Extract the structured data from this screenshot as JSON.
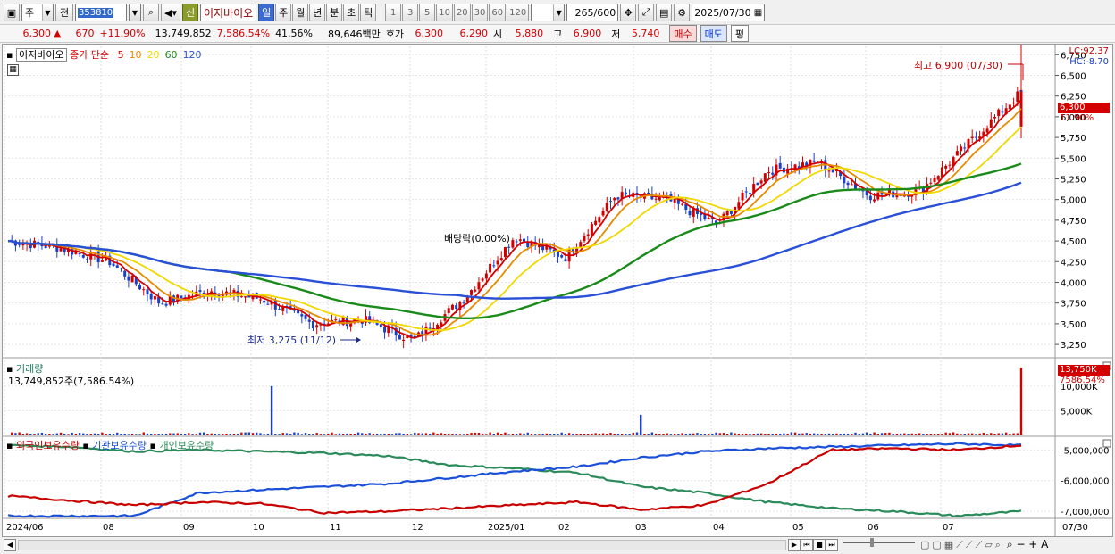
{
  "toolbar": {
    "market_select": "주",
    "prev_label": "전",
    "code": "353810",
    "sin_label": "신",
    "stock_name": "이지바이오",
    "periods": [
      "일",
      "주",
      "월",
      "년",
      "분",
      "초",
      "틱"
    ],
    "active_period": "일",
    "intervals": [
      "1",
      "3",
      "5",
      "10",
      "20",
      "30",
      "60",
      "120"
    ],
    "count": "265",
    "count_total": "/600",
    "date": "2025/07/30"
  },
  "quote": {
    "price": "6,300",
    "change": "670",
    "change_pct": "+11.90%",
    "volume": "13,749,852",
    "volume_ratio": "7,586.54%",
    "turnover": "41.56%",
    "amount": "89,646백만",
    "hoga_label": "호가",
    "ask": "6,300",
    "bid": "6,290",
    "open_label": "시",
    "open": "5,880",
    "high_label": "고",
    "high": "6,900",
    "low_label": "저",
    "low": "5,740",
    "buy_btn": "매수",
    "sell_btn": "매도",
    "eval_btn": "평"
  },
  "price_panel": {
    "stock_tag": "이지바이오",
    "ma_title": "종가 단순",
    "ma_periods": [
      "5",
      "10",
      "20",
      "60",
      "120"
    ],
    "ma_colors": [
      "#d40000",
      "#e68a00",
      "#f0d800",
      "#1a8a1a",
      "#2a50d8"
    ],
    "lc": "LC:92.37",
    "hc": "HC:-8.70",
    "high_annotation": "최고 6,900 (07/30)",
    "low_annotation": "최저 3,275 (11/12)",
    "dividend_annotation": "배당락(0.00%)",
    "last_price_tag": "6,300",
    "last_pct_tag": "11.90%",
    "y_ticks": [
      "6,750",
      "6,500",
      "6,250",
      "6,000",
      "5,750",
      "5,500",
      "5,250",
      "5,000",
      "4,750",
      "4,500",
      "4,250",
      "4,000",
      "3,750",
      "3,500",
      "3,250"
    ]
  },
  "volume_panel": {
    "title": "거래량",
    "value": "13,749,852주(7,586.54%)",
    "tag_value": "13,750K",
    "tag_pct": "7586.54%",
    "y_ticks": [
      "10,000K",
      "5,000K"
    ]
  },
  "holdings_panel": {
    "series": [
      {
        "name": "외국인보유수량",
        "color": "#c80000"
      },
      {
        "name": "기관보유수량",
        "color": "#1a4fd8"
      },
      {
        "name": "개인보유수량",
        "color": "#2a8a5a"
      }
    ],
    "y_ticks": [
      "-5,000,000",
      "-6,000,000",
      "-7,000,000"
    ]
  },
  "x_axis": [
    "2024/06",
    "08",
    "09",
    "10",
    "11",
    "12",
    "2025/01",
    "02",
    "03",
    "04",
    "05",
    "06",
    "07"
  ],
  "x_axis_right": "07/30",
  "chart_data": {
    "type": "candlestick",
    "x_range": [
      "2024/06",
      "2025/07/30"
    ],
    "ylim": [
      3100,
      6850
    ],
    "close_path": [
      {
        "date": "2024/06",
        "close": 4500
      },
      {
        "date": "2024/07",
        "close": 4420
      },
      {
        "date": "2024/08",
        "close": 4250
      },
      {
        "date": "2024/08 mid",
        "close": 3750
      },
      {
        "date": "2024/09",
        "close": 3900
      },
      {
        "date": "2024/10",
        "close": 3800
      },
      {
        "date": "2024/10 mid",
        "close": 3500
      },
      {
        "date": "2024/11",
        "close": 3550
      },
      {
        "date": "2024/11/12",
        "close": 3300
      },
      {
        "date": "2024/12",
        "close": 3800
      },
      {
        "date": "2024/12 end",
        "close": 4550
      },
      {
        "date": "2025/01",
        "close": 4300
      },
      {
        "date": "2025/01 mid",
        "close": 5050
      },
      {
        "date": "2025/02",
        "close": 5000
      },
      {
        "date": "2025/03",
        "close": 4700
      },
      {
        "date": "2025/04",
        "close": 5350
      },
      {
        "date": "2025/05",
        "close": 5450
      },
      {
        "date": "2025/06",
        "close": 5050
      },
      {
        "date": "2025/07",
        "close": 5100
      },
      {
        "date": "2025/07 end",
        "close": 5700
      },
      {
        "date": "2025/07/30",
        "close": 6300
      }
    ],
    "high": 6900,
    "low": 3275,
    "volume_spikes": [
      {
        "date": "2024/10",
        "value": 10000000
      },
      {
        "date": "2025/03",
        "value": 4200000
      },
      {
        "date": "2025/07/30",
        "value": 13749852
      }
    ],
    "holdings_range": [
      -7200000,
      -4700000
    ]
  }
}
